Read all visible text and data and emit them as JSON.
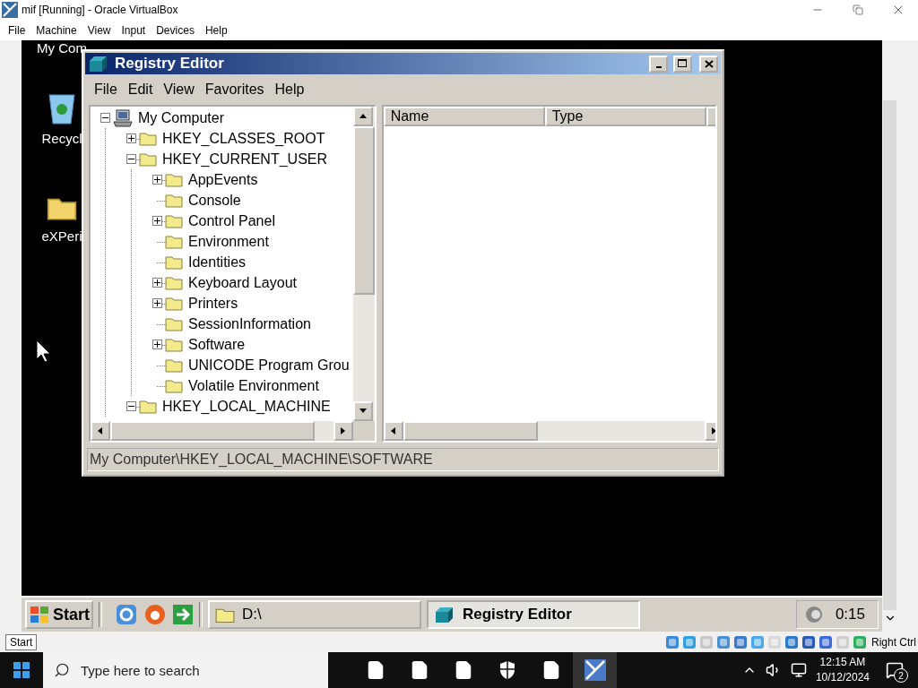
{
  "host_window": {
    "title": "mif [Running] - Oracle VirtualBox",
    "menu": [
      "File",
      "Machine",
      "View",
      "Input",
      "Devices",
      "Help"
    ]
  },
  "guest_desktop": {
    "icons": [
      {
        "label": "My Com"
      },
      {
        "label": "Recycl"
      },
      {
        "label": "eXPeri"
      }
    ]
  },
  "registry_editor": {
    "title": "Registry Editor",
    "menu": [
      "File",
      "Edit",
      "View",
      "Favorites",
      "Help"
    ],
    "tree": {
      "label": "My Computer",
      "kind": "branch",
      "expanded": true,
      "children": [
        {
          "label": "HKEY_CLASSES_ROOT",
          "kind": "branch",
          "expanded": false
        },
        {
          "label": "HKEY_CURRENT_USER",
          "kind": "branch",
          "expanded": true,
          "children": [
            {
              "label": "AppEvents",
              "kind": "branch",
              "expanded": false
            },
            {
              "label": "Console",
              "kind": "leaf"
            },
            {
              "label": "Control Panel",
              "kind": "branch",
              "expanded": false
            },
            {
              "label": "Environment",
              "kind": "leaf"
            },
            {
              "label": "Identities",
              "kind": "leaf"
            },
            {
              "label": "Keyboard Layout",
              "kind": "branch",
              "expanded": false
            },
            {
              "label": "Printers",
              "kind": "branch",
              "expanded": false
            },
            {
              "label": "SessionInformation",
              "kind": "leaf"
            },
            {
              "label": "Software",
              "kind": "branch",
              "expanded": false
            },
            {
              "label": "UNICODE Program Grou",
              "kind": "leaf"
            },
            {
              "label": "Volatile Environment",
              "kind": "leaf"
            }
          ]
        },
        {
          "label": "HKEY_LOCAL_MACHINE",
          "kind": "branch",
          "expanded": true
        }
      ]
    },
    "columns": [
      "Name",
      "Type"
    ],
    "status_bar": "My Computer\\HKEY_LOCAL_MACHINE\\SOFTWARE"
  },
  "guest_taskbar": {
    "start": "Start",
    "tasks": [
      {
        "label": "D:\\",
        "selected": false
      },
      {
        "label": "Registry Editor",
        "selected": true
      }
    ],
    "clock": "0:15"
  },
  "vbox_status": {
    "host_key": "Right Ctrl"
  },
  "tooltip": "Start",
  "host_taskbar": {
    "search_placeholder": "Type here to search",
    "time": "12:15 AM",
    "date": "10/12/2024",
    "notifications": "2"
  }
}
